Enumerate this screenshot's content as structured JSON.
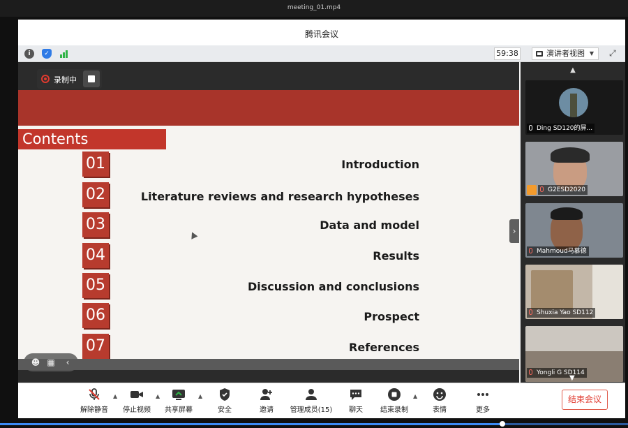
{
  "player": {
    "title": "meeting_01.mp4",
    "progress_pct": 80
  },
  "window": {
    "title": "腾讯会议"
  },
  "toolbar": {
    "timer": "59:38",
    "view_mode": "演讲者视图"
  },
  "recording": {
    "label": "录制中"
  },
  "slide": {
    "heading": "Contents",
    "items": [
      {
        "num": "01",
        "label": "Introduction"
      },
      {
        "num": "02",
        "label": "Literature reviews and research hypotheses"
      },
      {
        "num": "03",
        "label": "Data and model"
      },
      {
        "num": "04",
        "label": "Results"
      },
      {
        "num": "05",
        "label": "Discussion and conclusions"
      },
      {
        "num": "06",
        "label": "Prospect"
      },
      {
        "num": "07",
        "label": "References"
      }
    ]
  },
  "participants": [
    {
      "name": "Ding SD120的屏..."
    },
    {
      "name": "G2ESD2020"
    },
    {
      "name": "Mahmoud马慕德"
    },
    {
      "name": "Shuxia Yao SD112"
    },
    {
      "name": "Yongli G    SD114"
    }
  ],
  "controls": {
    "unmute": "解除静音",
    "stop_video": "停止视频",
    "share_screen": "共享屏幕",
    "security": "安全",
    "invite": "邀请",
    "manage_members": "管理成员(15)",
    "chat": "聊天",
    "end_recording": "结束录制",
    "reactions": "表情",
    "more": "更多",
    "end_meeting": "结束会议"
  },
  "colors": {
    "accent_red": "#c2362b",
    "end_red": "#e03a2f",
    "unmuted_green": "#2fb346"
  }
}
